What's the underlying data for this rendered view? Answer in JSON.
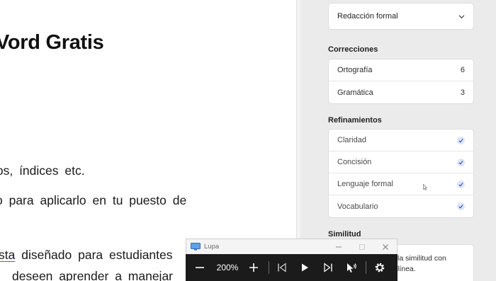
{
  "document": {
    "title": "Vord Gratis",
    "lines": [
      "tos, índices etc.",
      "o para aplicarlo en tu puesto de",
      "sta diseñado para estudiantes",
      "deseen aprender a manejar"
    ],
    "line3_prefix": "",
    "line3_underlined": "sta",
    "line3_rest": " diseñado para estudiantes"
  },
  "sidebar": {
    "style_select": {
      "value": "Redacción formal",
      "icon": "chevron-down-icon"
    },
    "corrections": {
      "title": "Correcciones",
      "items": [
        {
          "label": "Ortografía",
          "count": "6"
        },
        {
          "label": "Gramática",
          "count": "3"
        }
      ]
    },
    "refinements": {
      "title": "Refinamientos",
      "items": [
        {
          "label": "Claridad",
          "checked": true
        },
        {
          "label": "Concisión",
          "checked": true
        },
        {
          "label": "Lenguaje formal",
          "checked": true
        },
        {
          "label": "Vocabulario",
          "checked": true
        }
      ]
    },
    "similarity": {
      "title": "Similitud",
      "text_line1": "la similitud con",
      "text_line2": "línea."
    }
  },
  "magnifier": {
    "title": "Lupa",
    "zoom": "200%",
    "icons": [
      "magnifier-app-icon",
      "minimize-icon",
      "maximize-icon",
      "close-icon",
      "zoom-out-icon",
      "zoom-in-icon",
      "previous-icon",
      "play-icon",
      "next-icon",
      "read-from-pointer-icon",
      "settings-icon"
    ]
  }
}
